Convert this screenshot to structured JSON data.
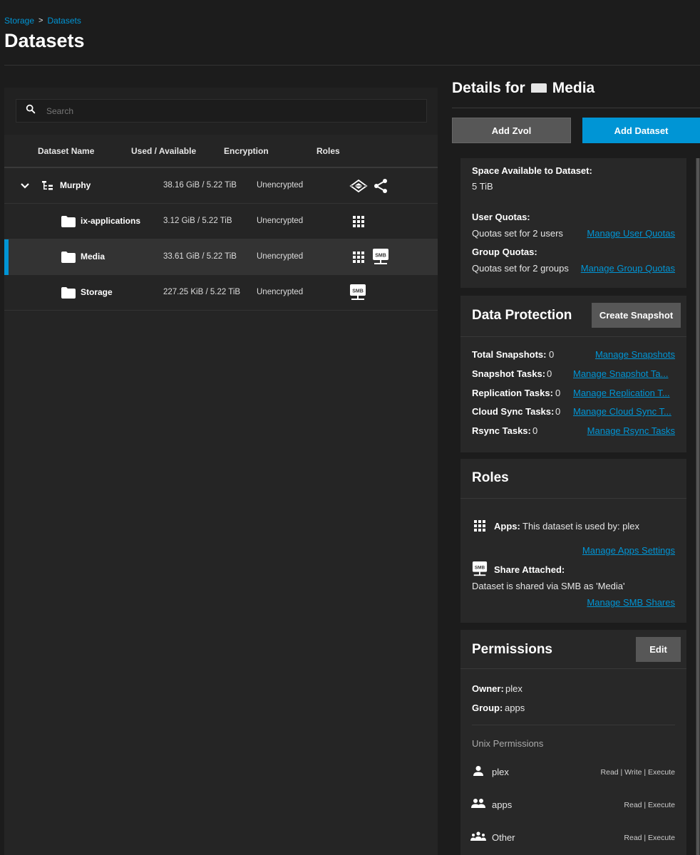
{
  "breadcrumb": {
    "storage": "Storage",
    "sep": ">",
    "datasets": "Datasets"
  },
  "page_title": "Datasets",
  "search": {
    "placeholder": "Search"
  },
  "table": {
    "headers": {
      "name": "Dataset Name",
      "used": "Used / Available",
      "encryption": "Encryption",
      "roles": "Roles"
    },
    "rows": [
      {
        "name": "Murphy",
        "used": "38.16 GiB / 5.22 TiB",
        "encryption": "Unencrypted",
        "roles": [
          "datacenter-icon",
          "share-icon"
        ]
      },
      {
        "name": "ix-applications",
        "used": "3.12 GiB / 5.22 TiB",
        "encryption": "Unencrypted",
        "roles": [
          "apps-icon"
        ]
      },
      {
        "name": "Media",
        "used": "33.61 GiB / 5.22 TiB",
        "encryption": "Unencrypted",
        "roles": [
          "apps-icon",
          "smb-icon"
        ]
      },
      {
        "name": "Storage",
        "used": "227.25 KiB / 5.22 TiB",
        "encryption": "Unencrypted",
        "roles": [
          "smb-icon"
        ]
      }
    ]
  },
  "details": {
    "title_prefix": "Details for",
    "title_name": "Media",
    "add_zvol": "Add Zvol",
    "add_dataset": "Add Dataset"
  },
  "space": {
    "available_label": "Space Available to Dataset:",
    "available_value": "5 TiB",
    "user_quotas_label": "User Quotas:",
    "user_quotas_value": "Quotas set for 2 users",
    "user_quotas_link": "Manage User Quotas",
    "group_quotas_label": "Group Quotas:",
    "group_quotas_value": "Quotas set for 2 groups",
    "group_quotas_link": "Manage Group Quotas"
  },
  "data_protection": {
    "title": "Data Protection",
    "create_snapshot": "Create Snapshot",
    "items": [
      {
        "label": "Total Snapshots:",
        "value": "0",
        "link": "Manage Snapshots"
      },
      {
        "label": "Snapshot Tasks:",
        "value": "0",
        "link": "Manage Snapshot Ta..."
      },
      {
        "label": "Replication Tasks:",
        "value": "0",
        "link": "Manage Replication T..."
      },
      {
        "label": "Cloud Sync Tasks:",
        "value": "0",
        "link": "Manage Cloud Sync T..."
      },
      {
        "label": "Rsync Tasks:",
        "value": "0",
        "link": "Manage Rsync Tasks"
      }
    ]
  },
  "roles": {
    "title": "Roles",
    "apps_label": "Apps:",
    "apps_value": "This dataset is used by: plex",
    "apps_link": "Manage Apps Settings",
    "share_label": "Share Attached:",
    "share_value": "Dataset is shared via SMB as 'Media'",
    "share_link": "Manage SMB Shares"
  },
  "permissions": {
    "title": "Permissions",
    "edit": "Edit",
    "owner_label": "Owner:",
    "owner_value": "plex",
    "group_label": "Group:",
    "group_value": "apps",
    "unix_label": "Unix Permissions",
    "entries": [
      {
        "name": "plex",
        "icon": "user-icon",
        "value": "Read | Write | Execute"
      },
      {
        "name": "apps",
        "icon": "group-icon",
        "value": "Read | Execute"
      },
      {
        "name": "Other",
        "icon": "others-icon",
        "value": "Read | Execute"
      }
    ]
  },
  "colors": {
    "accent": "#0095d5",
    "background": "#1c1c1c",
    "panel": "#252525",
    "card": "#282828"
  }
}
